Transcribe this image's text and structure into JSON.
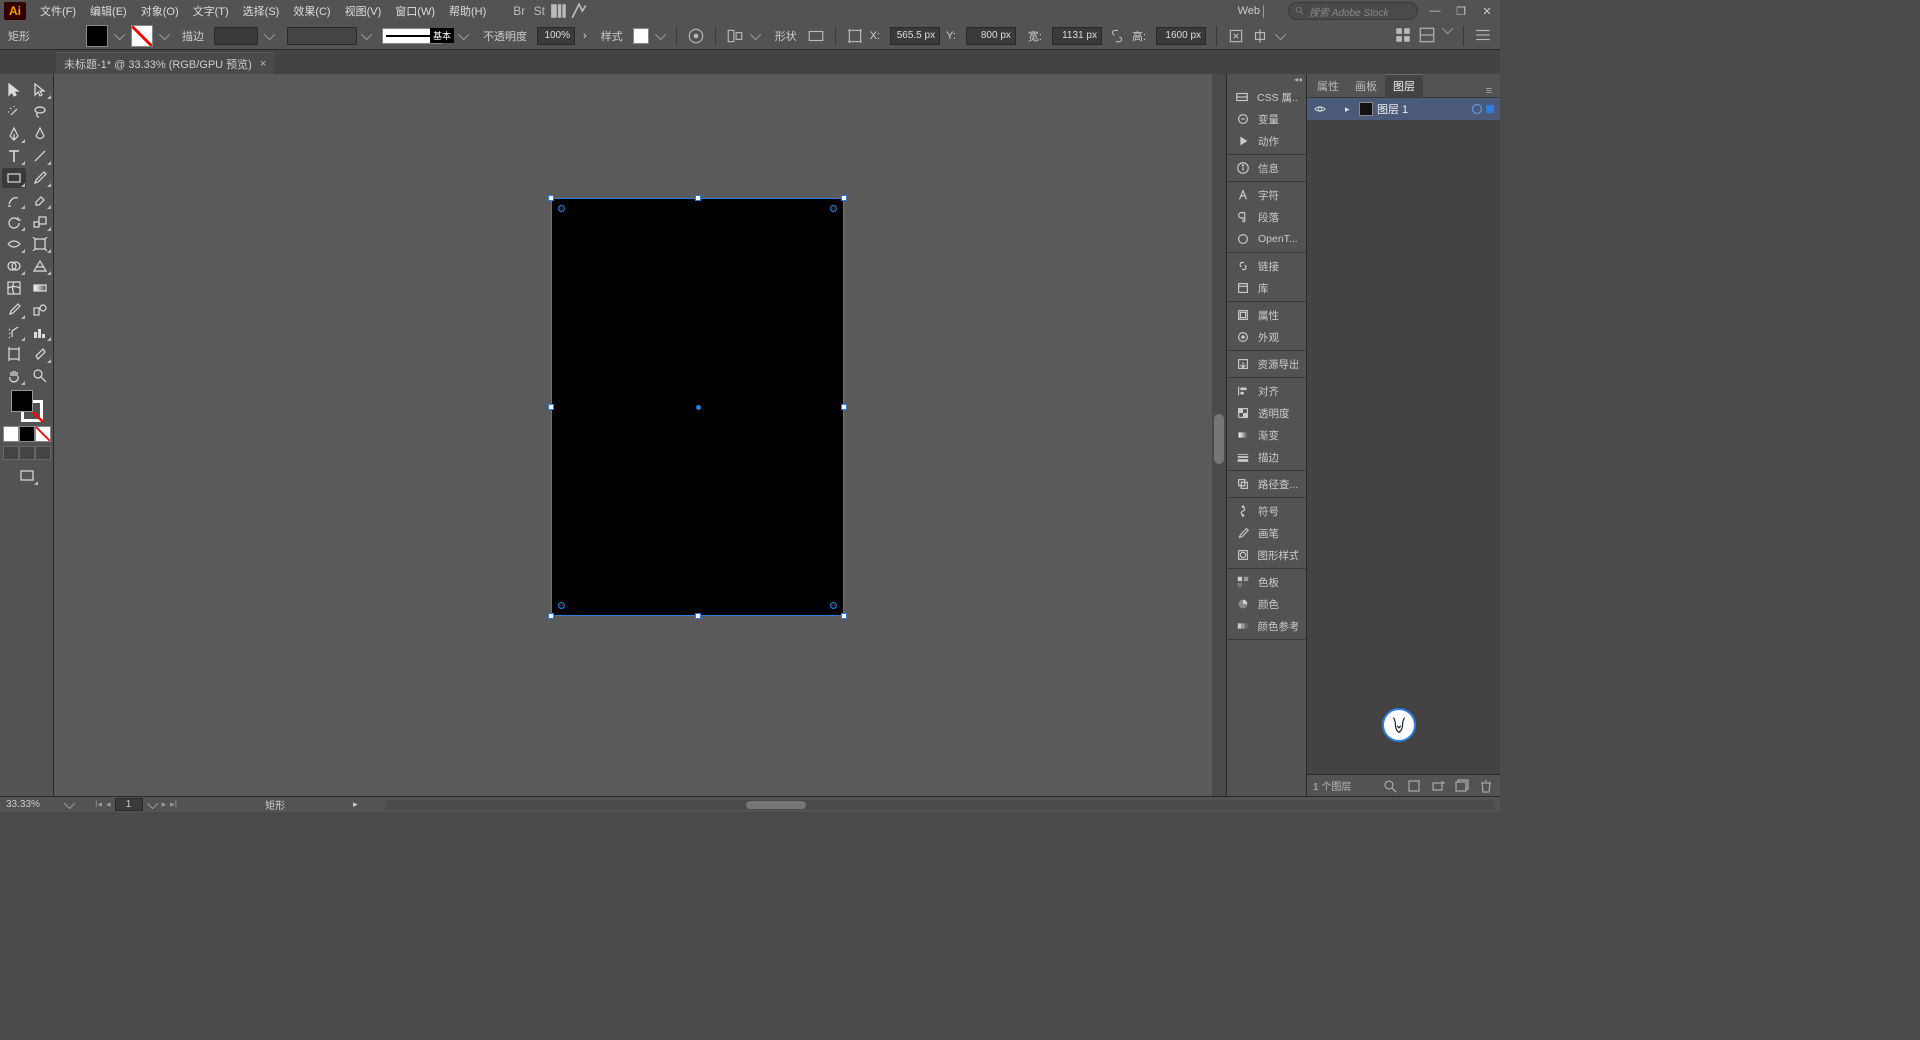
{
  "app": {
    "name": "Ai"
  },
  "menu": {
    "items": [
      "文件(F)",
      "编辑(E)",
      "对象(O)",
      "文字(T)",
      "选择(S)",
      "效果(C)",
      "视图(V)",
      "窗口(W)",
      "帮助(H)"
    ],
    "workspace": "Web",
    "search_placeholder": "搜索 Adobe Stock"
  },
  "options": {
    "shape_label": "矩形",
    "stroke_label": "描边",
    "stroke_pt": "",
    "stroke_style": "基本",
    "opacity_label": "不透明度",
    "opacity": "100%",
    "style_label": "样式",
    "shapekind_label": "形状",
    "x_label": "X:",
    "x": "565.5 px",
    "y_label": "Y:",
    "y": "800 px",
    "w_label": "宽:",
    "w": "1131 px",
    "h_label": "高:",
    "h": "1600 px"
  },
  "tab": {
    "title": "未标题-1* @ 33.33% (RGB/GPU 预览)"
  },
  "dock": {
    "groups": [
      [
        {
          "ic": "css",
          "lab": "CSS 属..."
        },
        {
          "ic": "var",
          "lab": "变量"
        },
        {
          "ic": "play",
          "lab": "动作"
        }
      ],
      [
        {
          "ic": "info",
          "lab": "信息"
        }
      ],
      [
        {
          "ic": "char",
          "lab": "字符"
        },
        {
          "ic": "para",
          "lab": "段落"
        },
        {
          "ic": "ot",
          "lab": "OpenT..."
        }
      ],
      [
        {
          "ic": "link",
          "lab": "链接"
        },
        {
          "ic": "lib",
          "lab": "库"
        }
      ],
      [
        {
          "ic": "attr",
          "lab": "属性"
        },
        {
          "ic": "appear",
          "lab": "外观"
        }
      ],
      [
        {
          "ic": "export",
          "lab": "资源导出"
        }
      ],
      [
        {
          "ic": "align",
          "lab": "对齐"
        },
        {
          "ic": "transp",
          "lab": "透明度"
        },
        {
          "ic": "grad",
          "lab": "渐变"
        },
        {
          "ic": "stroke",
          "lab": "描边"
        }
      ],
      [
        {
          "ic": "path",
          "lab": "路径查..."
        }
      ],
      [
        {
          "ic": "sym",
          "lab": "符号"
        },
        {
          "ic": "brush",
          "lab": "画笔"
        },
        {
          "ic": "gstyle",
          "lab": "图形样式"
        }
      ],
      [
        {
          "ic": "swatch",
          "lab": "色板"
        },
        {
          "ic": "color",
          "lab": "颜色"
        },
        {
          "ic": "cref",
          "lab": "颜色参考"
        }
      ]
    ]
  },
  "panel": {
    "tabs": [
      "属性",
      "画板",
      "图层"
    ],
    "active_tab": 2,
    "layer": {
      "name": "图层 1"
    },
    "footer_count": "1 个图层"
  },
  "status": {
    "zoom": "33.33%",
    "artboard": "1",
    "shape": "矩形"
  }
}
